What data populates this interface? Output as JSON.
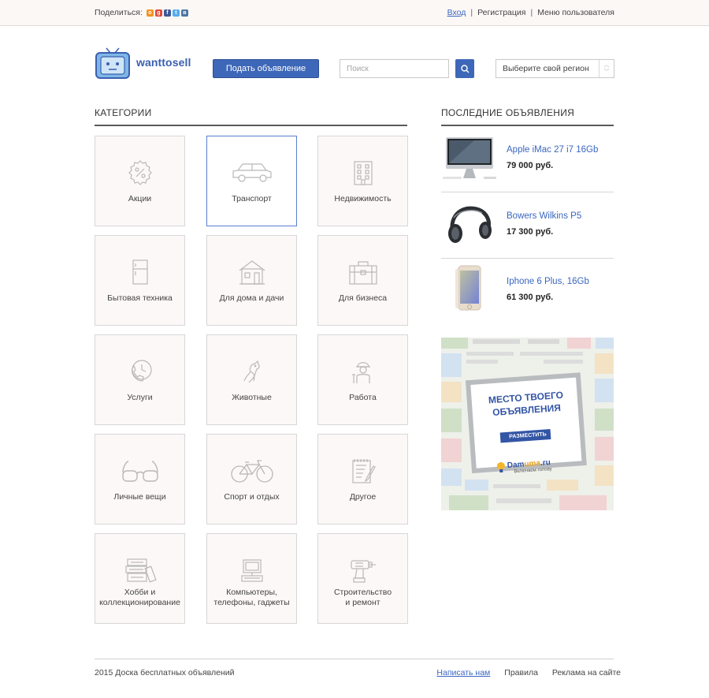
{
  "topbar": {
    "share_label": "Поделиться:",
    "share_icons": [
      {
        "icon": "odnoklassniki-icon",
        "color": "#f29322",
        "glyph": "o"
      },
      {
        "icon": "google-plus-icon",
        "color": "#dd4b39",
        "glyph": "g"
      },
      {
        "icon": "facebook-icon",
        "color": "#3b5998",
        "glyph": "f"
      },
      {
        "icon": "twitter-icon",
        "color": "#55acee",
        "glyph": "t"
      },
      {
        "icon": "vk-icon",
        "color": "#4c75a3",
        "glyph": "в"
      }
    ],
    "login": "Вход",
    "register": "Регистрация",
    "user_menu": "Меню пользователя"
  },
  "header": {
    "logo_text": "wanttosell",
    "post_button": "Подать объявление",
    "search_placeholder": "Поиск",
    "region_select": "Выберите свой регион",
    "accent_color": "#3d67b8"
  },
  "categories": {
    "heading": "КАТЕГОРИИ",
    "items": [
      {
        "label": "Акции",
        "icon": "discount-icon"
      },
      {
        "label": "Транспорт",
        "icon": "car-icon",
        "active": true
      },
      {
        "label": "Недвижимость",
        "icon": "building-icon"
      },
      {
        "label": "Бытовая техника",
        "icon": "fridge-icon"
      },
      {
        "label": "Для дома и дачи",
        "icon": "house-icon"
      },
      {
        "label": "Для бизнеса",
        "icon": "briefcase-icon"
      },
      {
        "label": "Услуги",
        "icon": "phone-icon"
      },
      {
        "label": "Животные",
        "icon": "animal-icon"
      },
      {
        "label": "Работа",
        "icon": "worker-icon"
      },
      {
        "label": "Личные вещи",
        "icon": "glasses-icon"
      },
      {
        "label": "Спорт и отдых",
        "icon": "bicycle-icon"
      },
      {
        "label": "Другое",
        "icon": "notepad-icon"
      },
      {
        "label_1": "Хобби и",
        "label_2": "коллекционирование",
        "icon": "stamps-icon"
      },
      {
        "label_1": "Компьютеры,",
        "label_2": "телефоны, гаджеты",
        "icon": "computer-icon"
      },
      {
        "label_1": "Строительство",
        "label_2": "и ремонт",
        "icon": "drill-icon"
      }
    ]
  },
  "latest": {
    "heading": "ПОСЛЕДНИЕ ОБЪЯВЛЕНИЯ",
    "ads": [
      {
        "title": "Apple iMac 27 i7 16Gb",
        "price": "79 000 руб.",
        "thumb": "imac-image"
      },
      {
        "title": "Bowers Wilkins P5",
        "price": "17 300 руб.",
        "thumb": "headphones-image"
      },
      {
        "title": "Iphone 6 Plus, 16Gb",
        "price": "61 300 руб.",
        "thumb": "iphone-image"
      }
    ]
  },
  "banner": {
    "line1": "МЕСТО ТВОЕГО",
    "line2": "ОБЪЯВЛЕНИЯ",
    "button": "РАЗМЕСТИТЬ",
    "brand_a": "Dam",
    "brand_b": "uma",
    "brand_c": ".ru",
    "tagline": "Включаем голову"
  },
  "footer": {
    "copyright": "2015 Доска бесплатных объявлений",
    "contact": "Написать нам",
    "rules": "Правила",
    "ads": "Реклама на сайте"
  }
}
